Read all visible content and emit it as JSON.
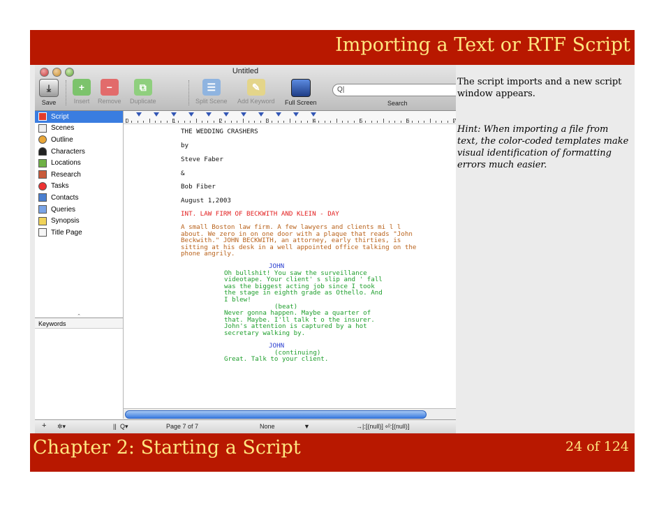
{
  "slide": {
    "title": "Importing a Text or RTF Script",
    "chapter": "Chapter 2: Starting a Script",
    "page": "24 of 124",
    "note": "The script imports and a new script window appears.",
    "hint": "Hint: When importing a file from text, the color-coded templates make visual identification of formatting errors much easier."
  },
  "window": {
    "title": "Untitled",
    "toolbar": [
      {
        "label": "Save",
        "icon": "save-icon",
        "enabled": true
      },
      {
        "label": "Insert",
        "icon": "plus-icon",
        "enabled": false
      },
      {
        "label": "Remove",
        "icon": "minus-icon",
        "enabled": false
      },
      {
        "label": "Duplicate",
        "icon": "duplicate-icon",
        "enabled": false
      },
      {
        "label": "Split Scene",
        "icon": "split-icon",
        "enabled": false
      },
      {
        "label": "Add Keyword",
        "icon": "keyword-icon",
        "enabled": false
      },
      {
        "label": "Full Screen",
        "icon": "fullscreen-icon",
        "enabled": true
      }
    ],
    "search": {
      "label": "Search",
      "value": "Q|"
    },
    "sidebar": [
      {
        "label": "Script",
        "icon": "script-icon",
        "selected": true
      },
      {
        "label": "Scenes",
        "icon": "scenes-icon"
      },
      {
        "label": "Outline",
        "icon": "outline-icon"
      },
      {
        "label": "Characters",
        "icon": "characters-icon"
      },
      {
        "label": "Locations",
        "icon": "locations-icon"
      },
      {
        "label": "Research",
        "icon": "research-icon"
      },
      {
        "label": "Tasks",
        "icon": "tasks-icon"
      },
      {
        "label": "Contacts",
        "icon": "contacts-icon"
      },
      {
        "label": "Queries",
        "icon": "queries-icon"
      },
      {
        "label": "Synopsis",
        "icon": "synopsis-icon"
      },
      {
        "label": "Title Page",
        "icon": "title-page-icon"
      }
    ],
    "keywords_label": "Keywords",
    "ruler": {
      "numbers": [
        "0",
        "1",
        "2",
        "3",
        "4",
        "5",
        "6",
        "7"
      ]
    },
    "script": {
      "title_lines": [
        "THE WEDDING CRASHERS",
        "by",
        "Steve Faber",
        "&",
        "Bob Fiber",
        "August 1,2003"
      ],
      "scene_heading": "INT. LAW FIRM OF BECKWITH AND KLEIN - DAY",
      "action": [
        "A small Boston law firm. A few lawyers and clients mi l l",
        "about. We zero in on one door with a plaque that reads \"John",
        "Beckwith.\" JOHN BECKWITH, an attorney, early thirties, is",
        "sitting at his desk in a well appointed office talking on the",
        "phone angrily."
      ],
      "character1": "JOHN",
      "dialogue1": [
        "Oh bullshit! You saw the surveillance",
        "videotape. Your client' s slip and ' fall",
        "was the biggest acting job since I took",
        "the stage in eighth grade as Othello. And",
        "I blew!"
      ],
      "paren1": "(beat)",
      "dialogue2": [
        "Never gonna happen. Maybe a quarter of",
        "that. Maybe. I'll talk t o the insurer.",
        "John's attention is captured by a hot",
        "secretary walking by."
      ],
      "character2": "JOHN",
      "paren2": "(continuing)",
      "dialogue3": "Great. Talk to your client."
    },
    "status": {
      "add": "+",
      "gear": "✲▾",
      "pause": "||",
      "find": "Q▾",
      "page": "Page 7 of 7",
      "none": "None",
      "arrow": "▼",
      "tabs": "→|:[(null)] ⏎:[(null)]"
    }
  }
}
